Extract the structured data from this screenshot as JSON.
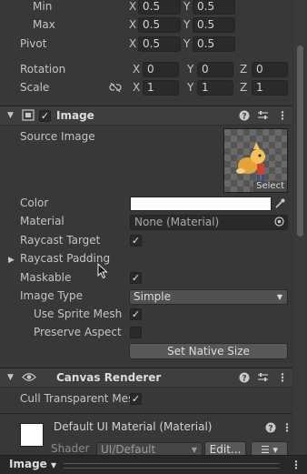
{
  "rect": {
    "min": {
      "label": "Min",
      "x": "0.5",
      "y": "0.5"
    },
    "max": {
      "label": "Max",
      "x": "0.5",
      "y": "0.5"
    },
    "pivot": {
      "label": "Pivot",
      "x": "0.5",
      "y": "0.5"
    },
    "rotation": {
      "label": "Rotation",
      "x": "0",
      "y": "0",
      "z": "0"
    },
    "scale": {
      "label": "Scale",
      "x": "1",
      "y": "1",
      "z": "1"
    },
    "axes": {
      "x": "X",
      "y": "Y",
      "z": "Z"
    }
  },
  "image_component": {
    "title": "Image",
    "source_image_label": "Source Image",
    "select_label": "Select",
    "color_label": "Color",
    "material_label": "Material",
    "material_value": "None (Material)",
    "raycast_target_label": "Raycast Target",
    "raycast_padding_label": "Raycast Padding",
    "maskable_label": "Maskable",
    "image_type_label": "Image Type",
    "image_type_value": "Simple",
    "use_sprite_mesh_label": "Use Sprite Mesh",
    "preserve_aspect_label": "Preserve Aspect",
    "set_native_size_label": "Set Native Size"
  },
  "canvas_renderer": {
    "title": "Canvas Renderer",
    "cull_label": "Cull Transparent Mes"
  },
  "material_section": {
    "title": "Default UI Material (Material)",
    "shader_label": "Shader",
    "shader_value": "UI/Default",
    "edit_label": "Edit..."
  },
  "bottom_bar": {
    "label": "Image"
  },
  "colors": {
    "background": "#383838",
    "field": "#2a2a2a",
    "header": "#3e3e3e",
    "color_swatch": "#ffffff"
  }
}
